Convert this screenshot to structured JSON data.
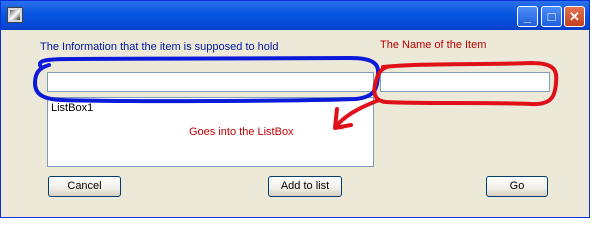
{
  "window": {
    "controls": {
      "minimize": "_",
      "maximize": "□",
      "close": "✕"
    }
  },
  "labels": {
    "info_hint": "The Information that the item is supposed to hold",
    "name_hint": "The Name of the Item",
    "goes_into": "Goes into the ListBox"
  },
  "fields": {
    "info_value": "",
    "name_value": ""
  },
  "listbox": {
    "items": [
      "ListBox1"
    ]
  },
  "buttons": {
    "cancel": "Cancel",
    "add": "Add to list",
    "go": "Go"
  },
  "colors": {
    "annotation_blue": "#0a1ad8",
    "annotation_red": "#e0101a"
  }
}
